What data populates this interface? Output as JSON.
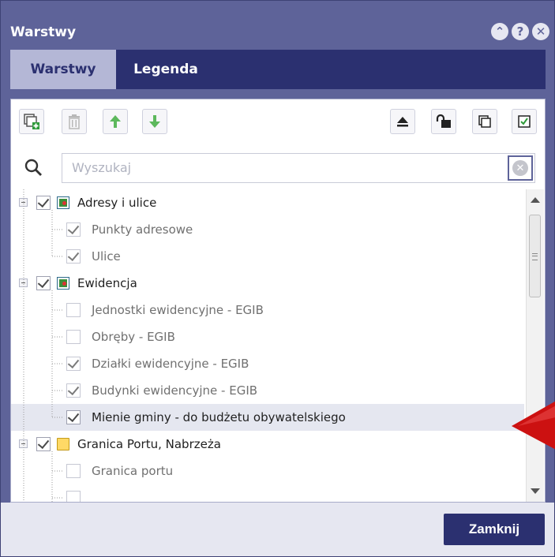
{
  "window": {
    "title": "Warstwy"
  },
  "title_buttons": {
    "collapse": "⌃",
    "help": "?",
    "close": "✕"
  },
  "tabs": [
    {
      "label": "Warstwy",
      "active": true
    },
    {
      "label": "Legenda",
      "active": false
    }
  ],
  "toolbar": {
    "left": [
      "add-layer-icon",
      "delete-icon",
      "move-up-icon",
      "move-down-icon"
    ],
    "right": [
      "eject-icon",
      "unlock-icon",
      "copy-icon",
      "check-all-icon"
    ]
  },
  "search": {
    "placeholder": "Wyszukaj",
    "value": ""
  },
  "tree": [
    {
      "label": "Adresy i ulice",
      "checked": true,
      "group": true,
      "icon": "layer-group-icon"
    },
    {
      "label": "Punkty adresowe",
      "checked": true,
      "group": false
    },
    {
      "label": "Ulice",
      "checked": true,
      "group": false
    },
    {
      "label": "Ewidencja",
      "checked": true,
      "group": true,
      "icon": "layer-group-icon"
    },
    {
      "label": "Jednostki ewidencyjne - EGIB",
      "checked": false,
      "group": false
    },
    {
      "label": "Obręby - EGIB",
      "checked": false,
      "group": false
    },
    {
      "label": "Działki ewidencyjne - EGIB",
      "checked": true,
      "group": false
    },
    {
      "label": "Budynki ewidencyjne - EGIB",
      "checked": true,
      "group": false
    },
    {
      "label": "Mienie gminy - do budżetu obywatelskiego",
      "checked": true,
      "group": false,
      "selected": true
    },
    {
      "label": "Granica Portu, Nabrzeża",
      "checked": true,
      "group": true,
      "icon": "folder-icon"
    },
    {
      "label": "Granica portu",
      "checked": false,
      "group": false
    }
  ],
  "footer": {
    "close_label": "Zamknij"
  },
  "colors": {
    "header": "#5e6399",
    "tabs_bg": "#2b3070",
    "active_tab": "#b4b7d6",
    "footer": "#e6e7f1",
    "annotation_arrow": "#cc1111"
  }
}
